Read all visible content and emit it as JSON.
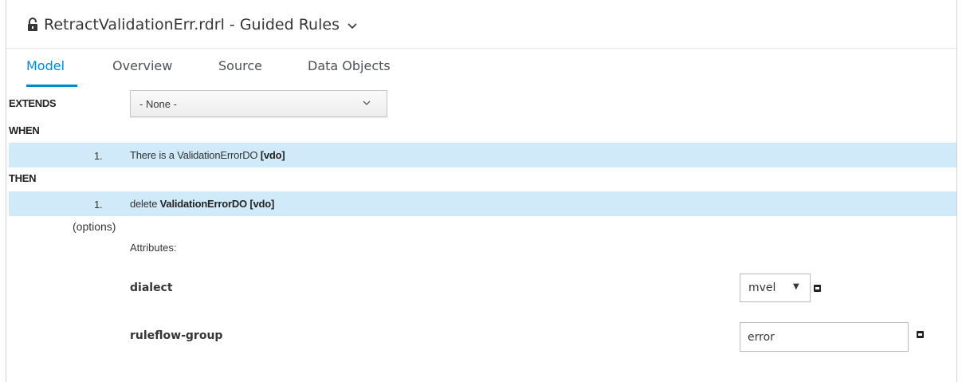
{
  "editor": {
    "title": "RetractValidationErr.rdrl - Guided Rules",
    "icons": {
      "lock": "lock-icon",
      "title_chevron": "chevron-down-icon"
    }
  },
  "tabs": [
    {
      "label": "Model",
      "active": true
    },
    {
      "label": "Overview",
      "active": false
    },
    {
      "label": "Source",
      "active": false
    },
    {
      "label": "Data Objects",
      "active": false
    }
  ],
  "rule": {
    "extends_label": "EXTENDS",
    "extends_value": "- None -",
    "when_label": "WHEN",
    "when_items": [
      {
        "number": "1.",
        "prefix": "There is a ValidationErrorDO",
        "binding": "[vdo]"
      }
    ],
    "then_label": "THEN",
    "then_items": [
      {
        "number": "1.",
        "prefix": "delete",
        "target": "ValidationErrorDO [vdo]"
      }
    ],
    "options_label": "(options)",
    "attributes_label": "Attributes:",
    "attributes": {
      "dialect": {
        "name": "dialect",
        "value": "mvel"
      },
      "ruleflow_group": {
        "name": "ruleflow-group",
        "value": "error"
      }
    }
  },
  "colors": {
    "accent": "#0088ce",
    "row_highlight": "#d1eaf9"
  }
}
